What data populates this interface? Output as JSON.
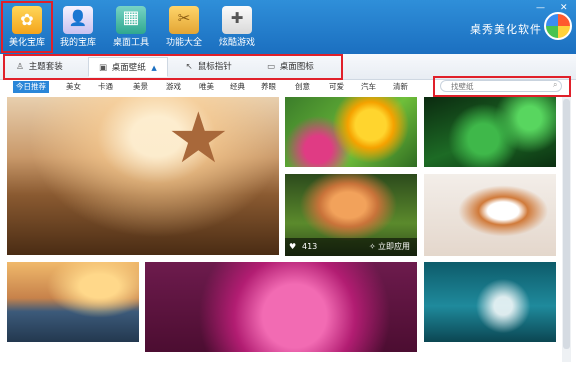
{
  "nav": {
    "items": [
      {
        "label": "美化宝库",
        "icon": "treasure-chest-icon"
      },
      {
        "label": "我的宝库",
        "icon": "user-icon"
      },
      {
        "label": "桌面工具",
        "icon": "desktop-tools-icon"
      },
      {
        "label": "功能大全",
        "icon": "toolbox-icon"
      },
      {
        "label": "炫酷游戏",
        "icon": "gamepad-icon"
      }
    ],
    "active_index": 0
  },
  "brand": {
    "name": "桌秀美化软件",
    "logo": "brand-logo"
  },
  "window_controls": {
    "minimize": "—",
    "close": "✕"
  },
  "subtabs": {
    "items": [
      {
        "label": "主题套装",
        "icon": "theme-icon"
      },
      {
        "label": "桌面壁纸",
        "icon": "wallpaper-icon"
      },
      {
        "label": "鼠标指针",
        "icon": "cursor-icon"
      },
      {
        "label": "桌面图标",
        "icon": "monitor-icon"
      }
    ],
    "active_index": 1
  },
  "categories": {
    "items": [
      "今日推荐",
      "美女",
      "卡通",
      "美景",
      "游戏",
      "唯美",
      "经典",
      "养眼",
      "创意",
      "可爱",
      "汽车",
      "清新"
    ],
    "active_index": 0
  },
  "search": {
    "placeholder": "找壁纸"
  },
  "tiles": {
    "kitten_overlay": {
      "likes": "413",
      "apply": "立即应用"
    }
  },
  "colors": {
    "topbar": "#1b6fc0",
    "highlight": "#e0202a",
    "active_category": "#2a86d8"
  }
}
